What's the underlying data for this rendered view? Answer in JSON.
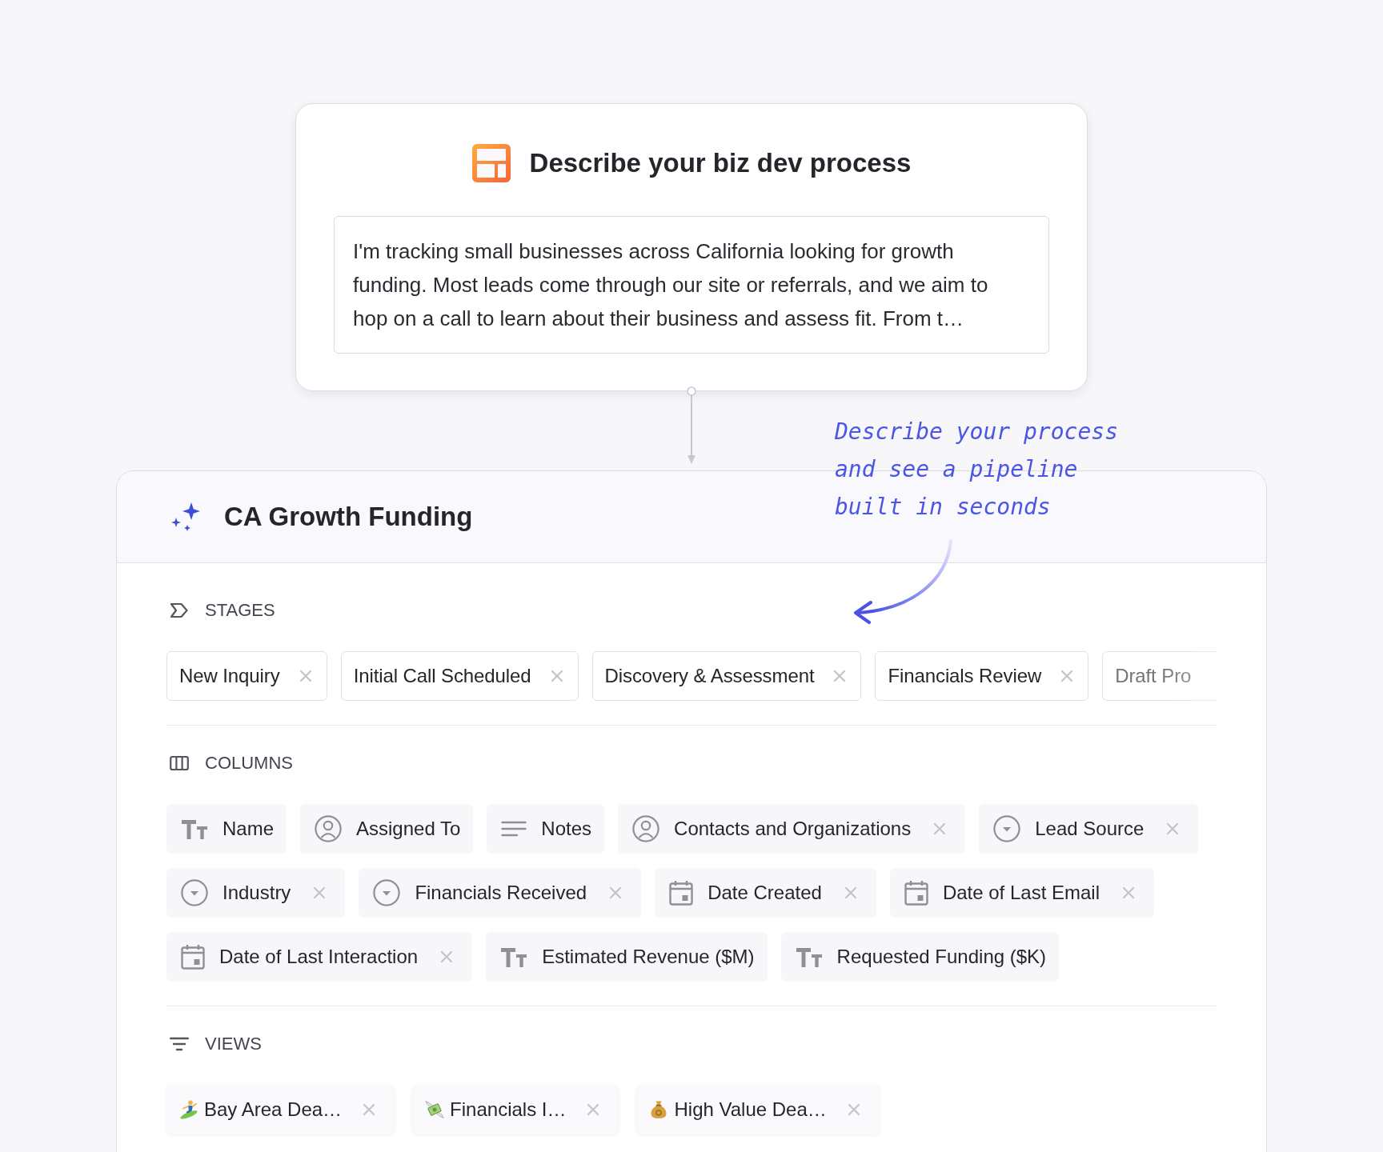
{
  "prompt_card": {
    "title": "Describe your biz dev process",
    "description": "I'm tracking small businesses across California looking for growth funding. Most leads come through our site or referrals, and we aim to hop on a call to learn about their business and assess fit. From t…"
  },
  "annotation": {
    "text": "Describe your process and see a pipeline built in seconds"
  },
  "pipeline": {
    "title": "CA Growth Funding",
    "stages": {
      "heading": "STAGES",
      "items": [
        {
          "label": "New Inquiry",
          "cut_off": false
        },
        {
          "label": "Initial Call Scheduled",
          "cut_off": false
        },
        {
          "label": "Discovery & Assessment",
          "cut_off": false
        },
        {
          "label": "Financials Review",
          "cut_off": false
        },
        {
          "label": "Draft Pro",
          "cut_off": true
        }
      ]
    },
    "columns": {
      "heading": "COLUMNS",
      "items": [
        {
          "label": "Name",
          "kind": "text",
          "removable": false
        },
        {
          "label": "Assigned To",
          "kind": "person",
          "removable": false
        },
        {
          "label": "Notes",
          "kind": "longtext",
          "removable": false
        },
        {
          "label": "Contacts and Organizations",
          "kind": "person",
          "removable": true
        },
        {
          "label": "Lead Source",
          "kind": "dropdown",
          "removable": true
        },
        {
          "label": "Industry",
          "kind": "dropdown",
          "removable": true
        },
        {
          "label": "Financials Received",
          "kind": "dropdown",
          "removable": true
        },
        {
          "label": "Date Created",
          "kind": "date",
          "removable": true
        },
        {
          "label": "Date of Last Email",
          "kind": "date",
          "removable": true
        },
        {
          "label": "Date of Last Interaction",
          "kind": "date",
          "removable": true
        },
        {
          "label": "Estimated Revenue ($M)",
          "kind": "text",
          "removable": false
        },
        {
          "label": "Requested Funding ($K)",
          "kind": "text",
          "removable": false
        }
      ]
    },
    "views": {
      "heading": "VIEWS",
      "items": [
        {
          "label": "Bay Area Dea…",
          "kind": "surf"
        },
        {
          "label": "Financials I…",
          "kind": "cash"
        },
        {
          "label": "High Value Dea…",
          "kind": "bag"
        }
      ]
    }
  }
}
